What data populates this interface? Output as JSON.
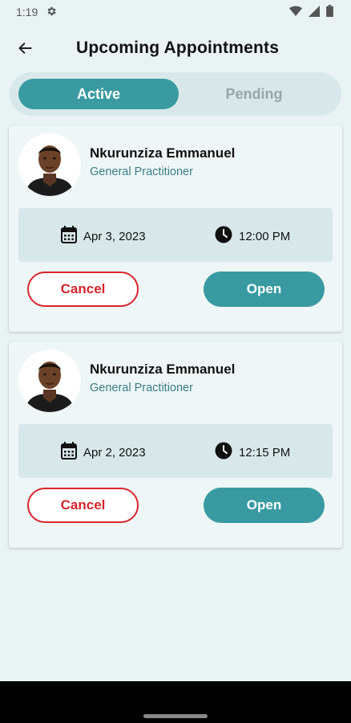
{
  "status_bar": {
    "time": "1:19",
    "icons": [
      "settings-icon",
      "wifi-icon",
      "signal-icon",
      "battery-icon"
    ]
  },
  "header": {
    "title": "Upcoming Appointments",
    "back_icon": "back-arrow-icon"
  },
  "tabs": [
    {
      "label": "Active",
      "selected": true
    },
    {
      "label": "Pending",
      "selected": false
    }
  ],
  "appointments": [
    {
      "doctor_name": "Nkurunziza Emmanuel",
      "specialty": "General Practitioner",
      "date": "Apr 3, 2023",
      "time": "12:00 PM",
      "cancel_label": "Cancel",
      "open_label": "Open"
    },
    {
      "doctor_name": "Nkurunziza Emmanuel",
      "specialty": "General Practitioner",
      "date": "Apr 2, 2023",
      "time": "12:15 PM",
      "cancel_label": "Cancel",
      "open_label": "Open"
    }
  ],
  "colors": {
    "background": "#e9f3f4",
    "accent": "#3a9aa2",
    "danger": "#d9252b",
    "muted_panel": "#d8e8ea",
    "specialty_text": "#3b7e85"
  }
}
